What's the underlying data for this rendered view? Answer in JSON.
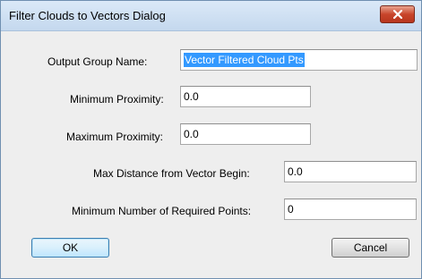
{
  "window": {
    "title": "Filter Clouds to Vectors Dialog"
  },
  "fields": {
    "output_group_name": {
      "label": "Output Group Name:",
      "value": "Vector Filtered Cloud Pts"
    },
    "minimum_proximity": {
      "label": "Minimum Proximity:",
      "value": "0.0"
    },
    "maximum_proximity": {
      "label": "Maximum Proximity:",
      "value": "0.0"
    },
    "max_distance": {
      "label": "Max Distance from Vector Begin:",
      "value": "0.0"
    },
    "min_points": {
      "label": "Minimum Number of Required Points:",
      "value": "0"
    }
  },
  "buttons": {
    "ok": "OK",
    "cancel": "Cancel"
  },
  "icons": {
    "close": "close-icon"
  },
  "colors": {
    "selection": "#3399ff",
    "close_button": "#c8452b"
  }
}
